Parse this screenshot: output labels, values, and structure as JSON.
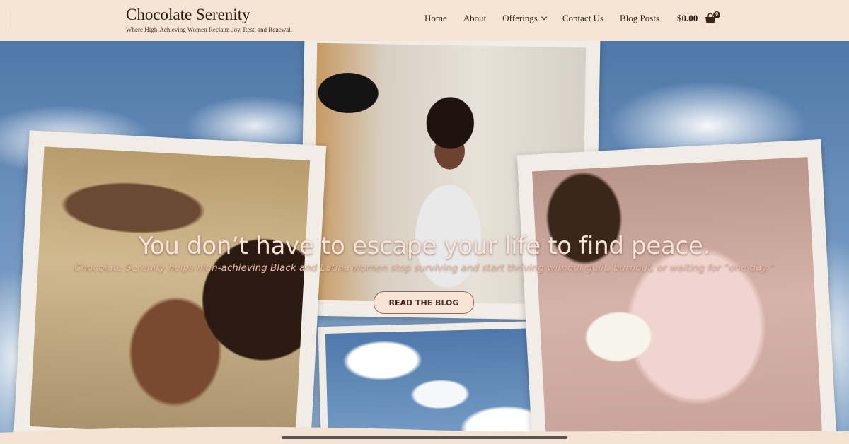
{
  "header": {
    "site_title": "Chocolate Serenity",
    "tagline": "Where High-Achieving Women Reclaim Joy, Rest, and Renewal.",
    "nav": {
      "home": "Home",
      "about": "About",
      "offerings": "Offerings",
      "contact": "Contact Us",
      "blog": "Blog Posts"
    },
    "cart_total": "$0.00",
    "cart_count": "0"
  },
  "hero": {
    "headline": "You don’t have to escape your life to find peace.",
    "subheadline": "Chocolate Serenity helps high-achieving Black and Latina women stop surviving and start thriving without guilt, burnout, or waiting for “one day.”",
    "cta_label": "READ THE BLOG"
  },
  "icons": {
    "offerings_dropdown": "chevron-down-icon",
    "cart": "shopping-bag-icon"
  },
  "colors": {
    "header_bg": "#f5e3d4",
    "headline_text": "#f6e3da",
    "subheadline_text": "#e9b9a3",
    "cta_bg": "#f6e3d6",
    "sky": "#5f86b5"
  }
}
